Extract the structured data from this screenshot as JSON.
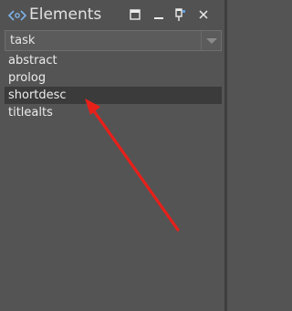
{
  "panel": {
    "title": "Elements",
    "title_icon": "xml-tags-icon",
    "buttons": [
      "float-icon",
      "minimize-icon",
      "pin-icon",
      "close-icon"
    ]
  },
  "filter": {
    "value": "task"
  },
  "list": {
    "items": [
      {
        "label": "abstract",
        "selected": false
      },
      {
        "label": "prolog",
        "selected": false
      },
      {
        "label": "shortdesc",
        "selected": true
      },
      {
        "label": "titlealts",
        "selected": false
      }
    ]
  },
  "annotation": {
    "arrow_color": "#e8201a"
  },
  "colors": {
    "background": "#545454",
    "selection": "#3b3b3b",
    "text": "#ececec"
  }
}
